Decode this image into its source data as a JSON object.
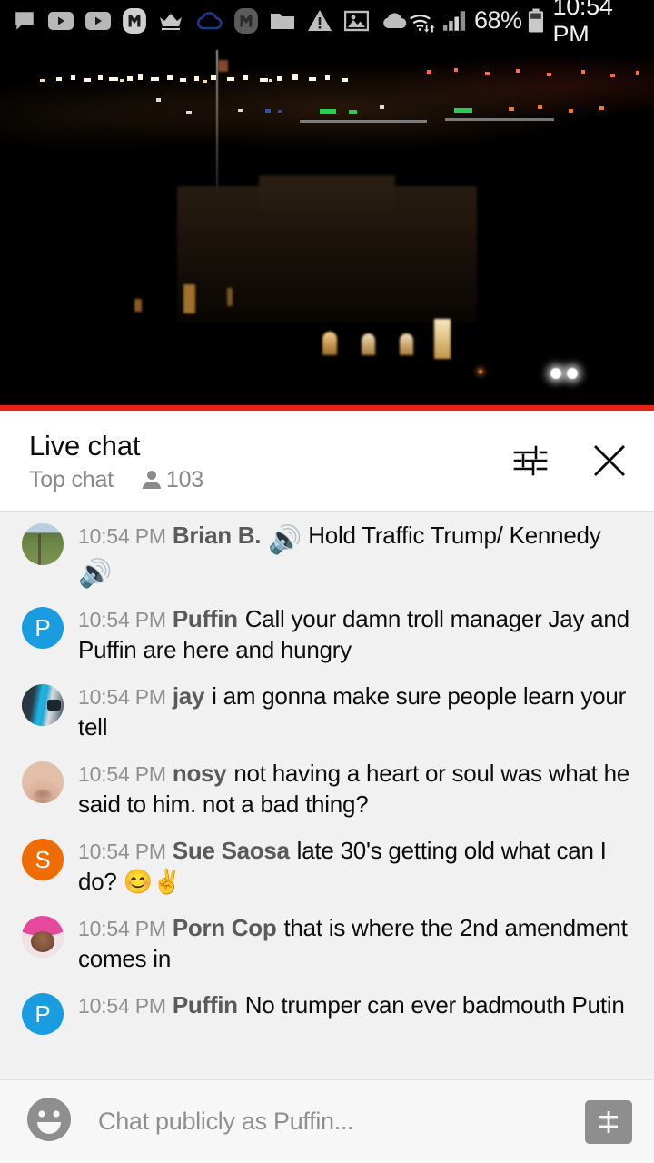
{
  "statusbar": {
    "icons": [
      {
        "name": "messaging-icon"
      },
      {
        "name": "youtube-icon"
      },
      {
        "name": "youtube-icon"
      },
      {
        "name": "mbit-app-icon"
      },
      {
        "name": "crown-icon"
      },
      {
        "name": "cloud-outline-icon"
      },
      {
        "name": "mbit-app-dim-icon"
      },
      {
        "name": "folder-icon"
      },
      {
        "name": "warning-triangle-icon"
      },
      {
        "name": "photo-icon"
      },
      {
        "name": "cloud-filled-icon"
      }
    ],
    "wifi_icon": "wifi-data-icon",
    "signal_icon": "cellular-signal-icon",
    "battery_percent": "68%",
    "battery_icon": "battery-icon",
    "clock": "10:54 PM"
  },
  "video": {
    "name": "live-video-player",
    "description": "night cityscape with distant lights and a dark building"
  },
  "chat_header": {
    "title": "Live chat",
    "mode": "Top chat",
    "viewer_icon": "person-icon",
    "viewer_count": "103",
    "settings_icon": "chat-settings-icon",
    "close_icon": "close-icon"
  },
  "messages": [
    {
      "timestamp": "10:54 PM",
      "author": "Brian B.",
      "avatar": "field",
      "avatar_letter": "",
      "avatar_color": "",
      "segments": [
        {
          "type": "emoji",
          "value": "🔊"
        },
        {
          "type": "text",
          "value": " Hold Traffic Trump/ Kennedy "
        },
        {
          "type": "emoji",
          "value": "🔊"
        }
      ],
      "text": "🔊 Hold Traffic Trump/ Kennedy 🔊"
    },
    {
      "timestamp": "10:54 PM",
      "author": "Puffin",
      "avatar": "letter",
      "avatar_letter": "P",
      "avatar_color": "#1a9ce0",
      "text": "Call your damn troll manager Jay and Puffin are here and hungry"
    },
    {
      "timestamp": "10:54 PM",
      "author": "jay",
      "avatar": "street",
      "avatar_letter": "",
      "avatar_color": "",
      "text": "i am gonna make sure people learn your tell"
    },
    {
      "timestamp": "10:54 PM",
      "author": "nosy",
      "avatar": "nose",
      "avatar_letter": "",
      "avatar_color": "",
      "text": "not having a heart or soul was what he said to him. not a bad thing?"
    },
    {
      "timestamp": "10:54 PM",
      "author": "Sue Saosa",
      "avatar": "letter",
      "avatar_letter": "S",
      "avatar_color": "#ef6c00",
      "text": "late 30's getting old what can I do? 😊✌"
    },
    {
      "timestamp": "10:54 PM",
      "author": "Porn Cop",
      "avatar": "pink",
      "avatar_letter": "",
      "avatar_color": "",
      "text": "that is where the 2nd amendment comes in"
    },
    {
      "timestamp": "10:54 PM",
      "author": "Puffin",
      "avatar": "letter",
      "avatar_letter": "P",
      "avatar_color": "#1a9ce0",
      "text": "No trumper can ever badmouth Putin"
    }
  ],
  "composer": {
    "emoji_icon": "emoji-face-icon",
    "placeholder": "Chat publicly as Puffin...",
    "value": "",
    "superchat_icon": "super-chat-dollar-icon"
  },
  "colors": {
    "brand_red": "#e62117",
    "chat_bg": "#f1f1f1",
    "header_bg": "#ffffff",
    "author_gray": "#5a5a5a",
    "timestamp_gray": "#909090"
  }
}
